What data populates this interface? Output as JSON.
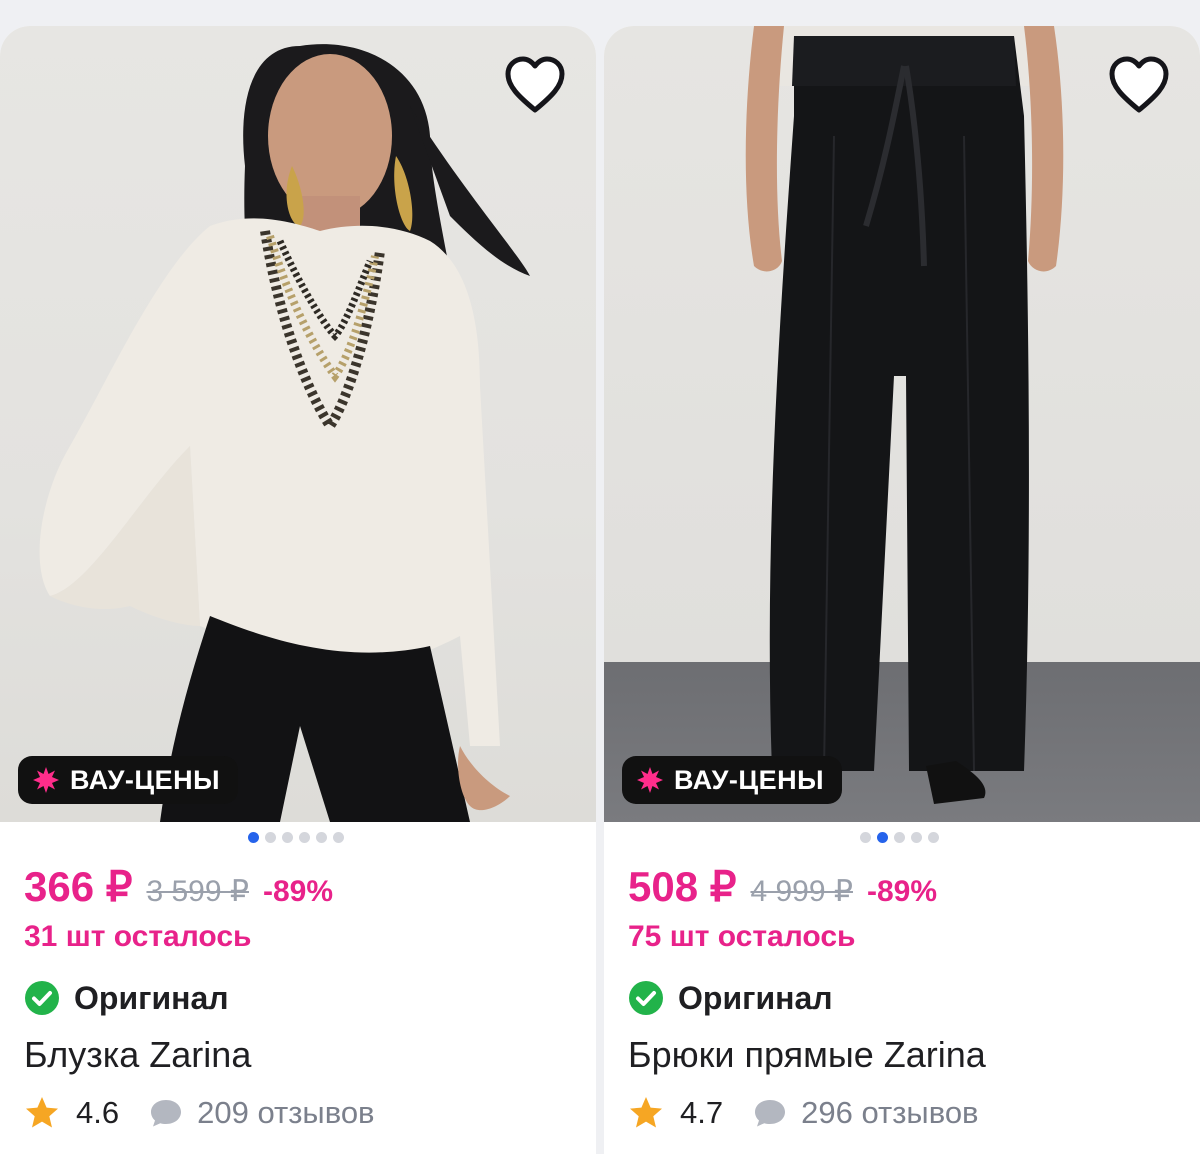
{
  "products": [
    {
      "badge": "ВАУ-ЦЕНЫ",
      "price": "366 ₽",
      "old_price": "3 599 ₽",
      "discount": "-89%",
      "stock": "31 шт осталось",
      "original_label": "Оригинал",
      "title": "Блузка Zarina",
      "rating": "4.6",
      "reviews": "209 отзывов",
      "images_count": 6,
      "active_image_index": 0,
      "favorite_icon": "heart-outline-icon"
    },
    {
      "badge": "ВАУ-ЦЕНЫ",
      "price": "508 ₽",
      "old_price": "4 999 ₽",
      "discount": "-89%",
      "stock": "75 шт осталось",
      "original_label": "Оригинал",
      "title": "Брюки прямые Zarina",
      "rating": "4.7",
      "reviews": "296 отзывов",
      "images_count": 5,
      "active_image_index": 1,
      "favorite_icon": "heart-outline-icon"
    }
  ],
  "colors": {
    "accent_pink": "#e8228a",
    "pagination_active": "#2563eb",
    "original_check": "#22b34a",
    "star": "#f6a623"
  }
}
